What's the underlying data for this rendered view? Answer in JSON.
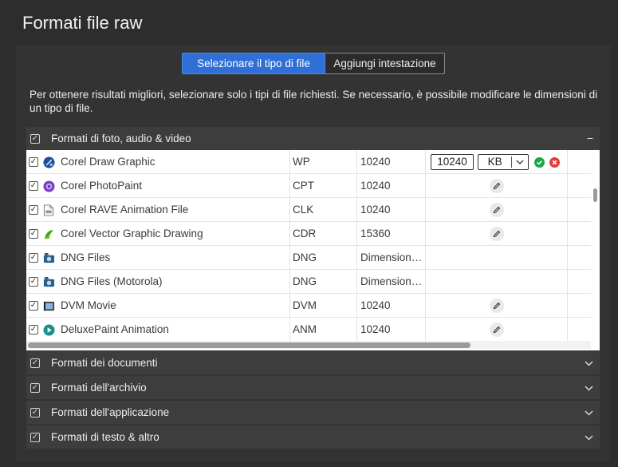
{
  "title": "Formati file raw",
  "tabs": {
    "select_type": "Selezionare il tipo di file",
    "add_header": "Aggiungi intestazione"
  },
  "info_text": "Per ottenere risultati migliori, selezionare solo i tipi di file richiesti. Se necessario, è possibile modificare le dimensioni di un tipo di file.",
  "sections": [
    {
      "label": "Formati di foto, audio & video",
      "toggle": "−",
      "checked": true,
      "expanded": true
    },
    {
      "label": "Formati dei documenti",
      "toggle": "⌄",
      "checked": true,
      "expanded": false
    },
    {
      "label": "Formati dell'archivio",
      "toggle": "⌄",
      "checked": true,
      "expanded": false
    },
    {
      "label": "Formati dell'applicazione",
      "toggle": "⌄",
      "checked": true,
      "expanded": false
    },
    {
      "label": "Formati di testo & altro",
      "toggle": "⌄",
      "checked": true,
      "expanded": false
    }
  ],
  "rows": [
    {
      "name": "Corel Draw Graphic",
      "ext": "WP",
      "size": "10240",
      "icon": "corel-draw-icon",
      "editing": true
    },
    {
      "name": "Corel PhotoPaint",
      "ext": "CPT",
      "size": "10240",
      "icon": "corel-photopaint-icon"
    },
    {
      "name": "Corel RAVE Animation File",
      "ext": "CLK",
      "size": "10240",
      "icon": "file-icon"
    },
    {
      "name": "Corel Vector Graphic Drawing",
      "ext": "CDR",
      "size": "15360",
      "icon": "corel-vector-icon"
    },
    {
      "name": "DNG Files",
      "ext": "DNG",
      "size": "Dimension…",
      "icon": "camera-icon"
    },
    {
      "name": "DNG Files (Motorola)",
      "ext": "DNG",
      "size": "Dimension…",
      "icon": "camera-icon"
    },
    {
      "name": "DVM Movie",
      "ext": "DVM",
      "size": "10240",
      "icon": "movie-icon"
    },
    {
      "name": "DeluxePaint Animation",
      "ext": "ANM",
      "size": "10240",
      "icon": "play-icon"
    }
  ],
  "editor": {
    "size_value": "10240",
    "unit": "KB"
  },
  "colors": {
    "accent": "#2f6fd6",
    "ok": "#1aa64a",
    "cancel": "#e23b3b"
  }
}
